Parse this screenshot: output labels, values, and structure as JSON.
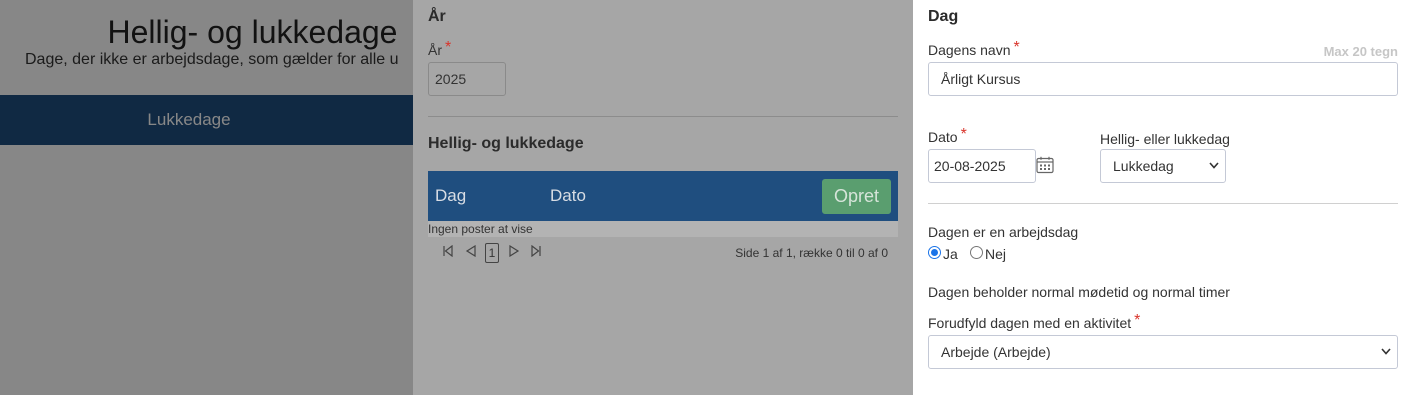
{
  "background": {
    "title": "Hellig- og lukkedage",
    "subtitle": "Dage, der ikke er arbejdsdage, som gælder for alle u",
    "tab_label": "Lukkedage"
  },
  "middle": {
    "year_section_title": "År",
    "year_label": "År",
    "year_value": "2025",
    "holidays_title": "Hellig- og lukkedage",
    "grid": {
      "columns": [
        "Dag",
        "Dato"
      ],
      "create_label": "Opret",
      "empty_text": "Ingen poster at vise"
    },
    "pager": {
      "current_page": "1",
      "info": "Side 1 af 1, række 0 til 0 af 0"
    }
  },
  "right": {
    "section_title": "Dag",
    "day_name_label": "Dagens navn",
    "day_name_hint": "Max 20 tegn",
    "day_name_value": "Årligt Kursus",
    "date_label": "Dato",
    "date_value": "20-08-2025",
    "type_label": "Hellig- eller lukkedag",
    "type_value": "Lukkedag",
    "workday_label": "Dagen er en arbejdsdag",
    "workday_yes": "Ja",
    "workday_no": "Nej",
    "workday_selected": "Ja",
    "normal_time_text": "Dagen beholder normal mødetid og normal timer",
    "prefill_label": "Forudfyld dagen med en aktivitet",
    "prefill_value": "Arbejde (Arbejde)"
  },
  "colors": {
    "header_blue": "#1f4e7f",
    "create_green": "#5a9e6f",
    "required_red": "#d9342b",
    "radio_blue": "#1a73e8"
  }
}
